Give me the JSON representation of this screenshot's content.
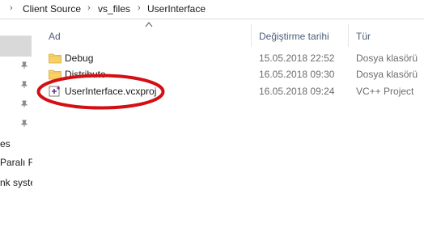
{
  "breadcrumb": {
    "items": [
      "Client Source",
      "vs_files",
      "UserInterface"
    ]
  },
  "nav": {
    "partial_items": [
      "es",
      "Paralı F",
      "nk syste"
    ]
  },
  "columns": {
    "name": "Ad",
    "date": "Değiştirme tarihi",
    "type": "Tür"
  },
  "files": [
    {
      "name": "Debug",
      "date": "15.05.2018 22:52",
      "type": "Dosya klasörü",
      "icon": "folder-icon"
    },
    {
      "name": "Distribute",
      "date": "16.05.2018 09:30",
      "type": "Dosya klasörü",
      "icon": "folder-icon"
    },
    {
      "name": "UserInterface.vcxproj",
      "date": "16.05.2018 09:24",
      "type": "VC++ Project",
      "icon": "vcxproj-icon"
    }
  ],
  "colors": {
    "annotation": "#d40f14",
    "folder": "#f6d16a",
    "header_text": "#4c607a"
  }
}
